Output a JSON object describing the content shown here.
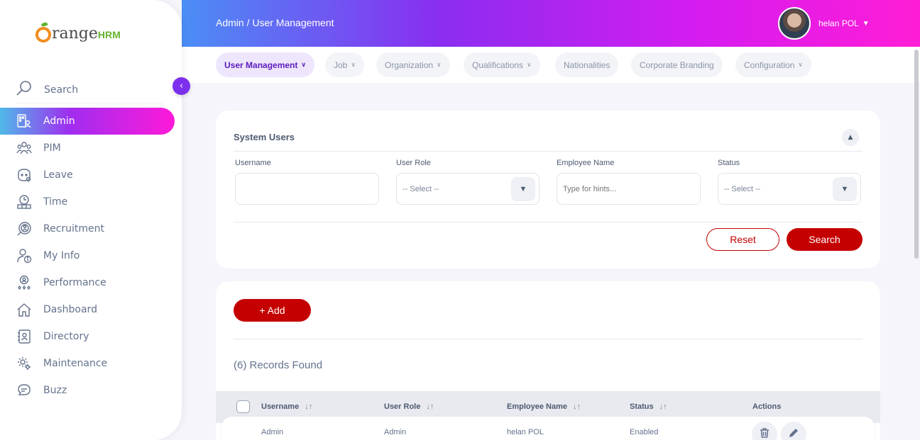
{
  "brand": {
    "logo_text_1": "range",
    "logo_text_2": "HRM"
  },
  "sidebar": {
    "search_label": "Search",
    "items": [
      {
        "label": "Admin",
        "icon": "admin-icon",
        "active": true
      },
      {
        "label": "PIM",
        "icon": "pim-icon"
      },
      {
        "label": "Leave",
        "icon": "leave-icon"
      },
      {
        "label": "Time",
        "icon": "time-icon"
      },
      {
        "label": "Recruitment",
        "icon": "recruitment-icon"
      },
      {
        "label": "My Info",
        "icon": "my-info-icon"
      },
      {
        "label": "Performance",
        "icon": "performance-icon"
      },
      {
        "label": "Dashboard",
        "icon": "dashboard-icon"
      },
      {
        "label": "Directory",
        "icon": "directory-icon"
      },
      {
        "label": "Maintenance",
        "icon": "maintenance-icon"
      },
      {
        "label": "Buzz",
        "icon": "buzz-icon"
      }
    ]
  },
  "header": {
    "breadcrumb": "Admin / User Management",
    "user_name": "helan POL"
  },
  "tabs": [
    {
      "label": "User Management",
      "dropdown": true,
      "active": true
    },
    {
      "label": "Job",
      "dropdown": true
    },
    {
      "label": "Organization",
      "dropdown": true
    },
    {
      "label": "Qualifications",
      "dropdown": true
    },
    {
      "label": "Nationalities",
      "dropdown": false
    },
    {
      "label": "Corporate Branding",
      "dropdown": false
    },
    {
      "label": "Configuration",
      "dropdown": true
    }
  ],
  "filters": {
    "title": "System Users",
    "username_label": "Username",
    "username_value": "",
    "user_role_label": "User Role",
    "user_role_value": "-- Select --",
    "employee_name_label": "Employee Name",
    "employee_name_placeholder": "Type for hints...",
    "status_label": "Status",
    "status_value": "-- Select --",
    "reset_label": "Reset",
    "search_label": "Search"
  },
  "list": {
    "add_label": "+  Add",
    "records_found": "(6) Records Found",
    "columns": [
      "Username",
      "User Role",
      "Employee Name",
      "Status",
      "Actions"
    ],
    "rows": [
      {
        "username": "Admin",
        "user_role": "Admin",
        "employee_name": "helan POL",
        "status": "Enabled"
      }
    ]
  },
  "colors": {
    "accent": "#c50000",
    "brand_purple": "#7c30ee",
    "gradient_start": "#4b8ef5",
    "gradient_end": "#ff1dd6"
  }
}
